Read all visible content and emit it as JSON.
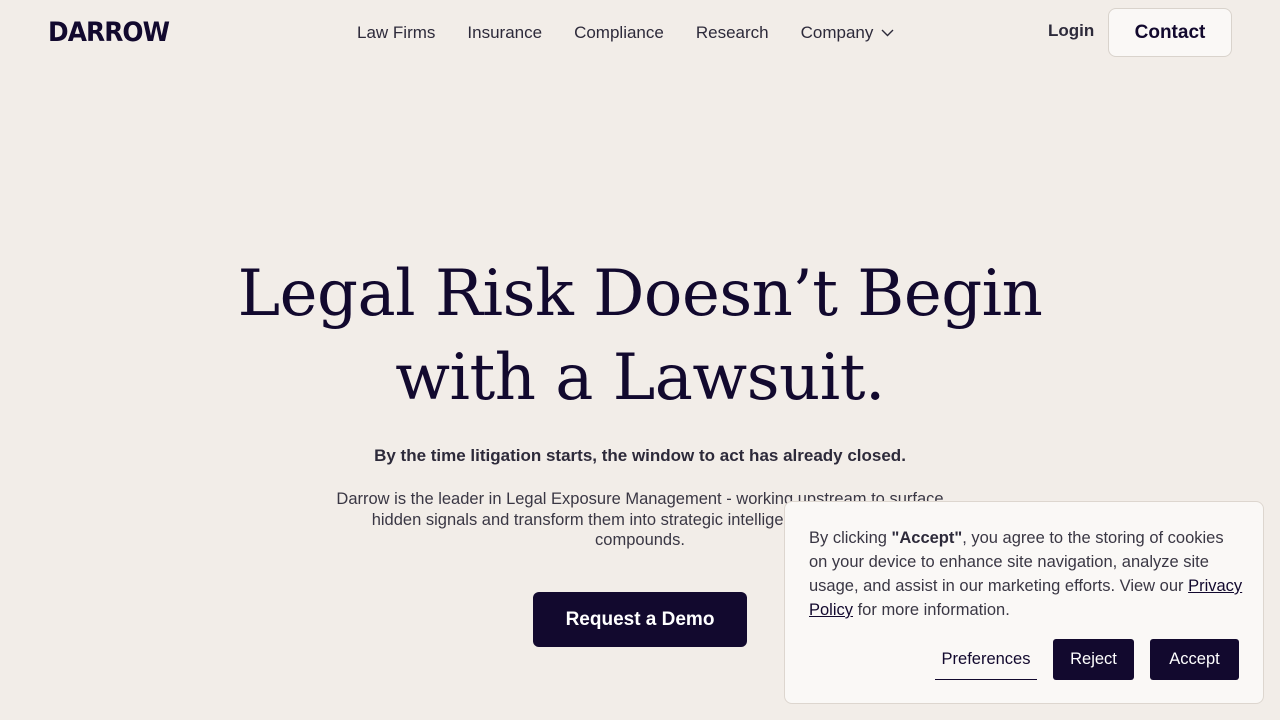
{
  "header": {
    "logo": "DARROW",
    "nav": [
      {
        "label": "Law Firms"
      },
      {
        "label": "Insurance"
      },
      {
        "label": "Compliance"
      },
      {
        "label": "Research"
      },
      {
        "label": "Company",
        "icon": "chevron-down-icon"
      }
    ],
    "login_label": "Login",
    "contact_label": "Contact"
  },
  "hero": {
    "title_line1": "Legal Risk Doesn’t Begin",
    "title_line2": "with a Lawsuit.",
    "subtitle": "By the time litigation starts, the window to act has already closed.",
    "description": "Darrow is the leader in Legal Exposure Management - working upstream to surface hidden signals and transform them into strategic intelligence, before harm compounds.",
    "cta_label": "Request a Demo"
  },
  "cookie": {
    "text_pre": "By clicking ",
    "text_bold": "\"Accept\"",
    "text_mid": ", you agree to the storing of cookies on your device to enhance site navigation, analyze site usage, and assist in our marketing efforts. View our ",
    "link_label": "Privacy Policy",
    "text_post": " for more information.",
    "preferences_label": "Preferences",
    "reject_label": "Reject",
    "accept_label": "Accept"
  },
  "colors": {
    "background": "#f2ede8",
    "brand_dark": "#12092e",
    "panel": "#faf8f6"
  }
}
